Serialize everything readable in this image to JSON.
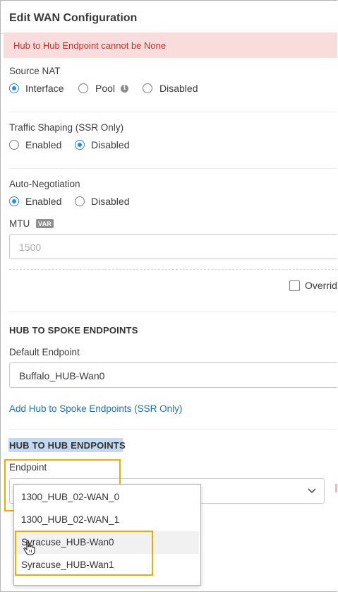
{
  "header": {
    "title": "Edit WAN Configuration"
  },
  "error": {
    "message": "Hub to Hub Endpoint cannot be None"
  },
  "source_nat": {
    "label": "Source NAT",
    "options": [
      {
        "label": "Interface",
        "selected": true
      },
      {
        "label": "Pool",
        "selected": false,
        "icon": "info-icon"
      },
      {
        "label": "Disabled",
        "selected": false
      }
    ]
  },
  "traffic_shaping": {
    "label": "Traffic Shaping (SSR Only)",
    "options": [
      {
        "label": "Enabled",
        "selected": false
      },
      {
        "label": "Disabled",
        "selected": true
      }
    ]
  },
  "auto_negotiation": {
    "label": "Auto-Negotiation",
    "options": [
      {
        "label": "Enabled",
        "selected": true
      },
      {
        "label": "Disabled",
        "selected": false
      }
    ]
  },
  "mtu": {
    "label": "MTU",
    "badge": "VAR",
    "placeholder": "1500"
  },
  "override": {
    "label": "Overrid"
  },
  "hub_to_spoke": {
    "heading": "HUB TO SPOKE ENDPOINTS",
    "default_endpoint_label": "Default Endpoint",
    "default_endpoint_value": "Buffalo_HUB-Wan0",
    "add_link": "Add Hub to Spoke Endpoints (SSR Only)"
  },
  "hub_to_hub": {
    "heading": "HUB TO HUB ENDPOINTS",
    "endpoint_label": "Endpoint",
    "dropdown_options": [
      "1300_HUB_02-WAN_0",
      "1300_HUB_02-WAN_1",
      "Syracuse_HUB-Wan0",
      "Syracuse_HUB-Wan1"
    ]
  },
  "colors": {
    "accent_blue": "#2d8bd0",
    "error_text": "#c0322b",
    "error_bg": "#f9dcdc",
    "link": "#1f6fb5",
    "highlight_box": "#f2a900"
  }
}
